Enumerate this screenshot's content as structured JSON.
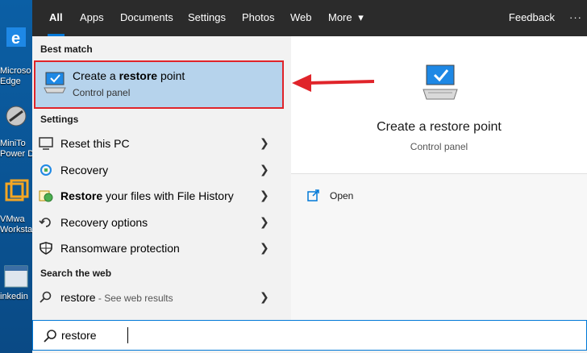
{
  "desktop": {
    "icons": [
      {
        "name": "edge",
        "label": "Microsoft Edge",
        "lines": [
          "Microso",
          "Edge"
        ]
      },
      {
        "name": "minitool",
        "label": "MiniTool Power Data",
        "lines": [
          "MiniTo",
          "Power D"
        ]
      },
      {
        "name": "vmware",
        "label": "VMware Workstation",
        "lines": [
          "VMwa",
          "Worksta"
        ]
      },
      {
        "name": "linkedin",
        "label": "Linkedin",
        "lines": [
          "inkedin"
        ]
      }
    ]
  },
  "tabs": {
    "items": [
      {
        "label": "All",
        "active": true
      },
      {
        "label": "Apps"
      },
      {
        "label": "Documents"
      },
      {
        "label": "Settings"
      },
      {
        "label": "Photos"
      },
      {
        "label": "Web"
      },
      {
        "label": "More"
      }
    ],
    "more_caret": "▾",
    "feedback": "Feedback",
    "dots": "···"
  },
  "best_match": {
    "header": "Best match",
    "title_prefix": "Create a ",
    "title_bold": "restore",
    "title_suffix": " point",
    "subtitle": "Control panel"
  },
  "settings": {
    "header": "Settings",
    "items": [
      {
        "label": "Reset this PC",
        "icon": "reset-pc-icon"
      },
      {
        "label": "Recovery",
        "icon": "recovery-icon"
      },
      {
        "label_bold": "Restore",
        "label_rest": " your files with File History",
        "icon": "file-history-icon"
      },
      {
        "label": "Recovery options",
        "icon": "recovery-options-icon"
      },
      {
        "label": "Ransomware protection",
        "icon": "shield-icon"
      }
    ]
  },
  "web": {
    "header": "Search the web",
    "query": "restore",
    "suffix": " - See web results"
  },
  "preview": {
    "title": "Create a restore point",
    "subtitle": "Control panel",
    "open_label": "Open"
  },
  "search": {
    "value": "restore"
  },
  "colors": {
    "accent": "#0078d7",
    "highlight_border": "#e0242a",
    "selection": "#b6d3ec",
    "tab_bar": "#2b2b2b"
  }
}
